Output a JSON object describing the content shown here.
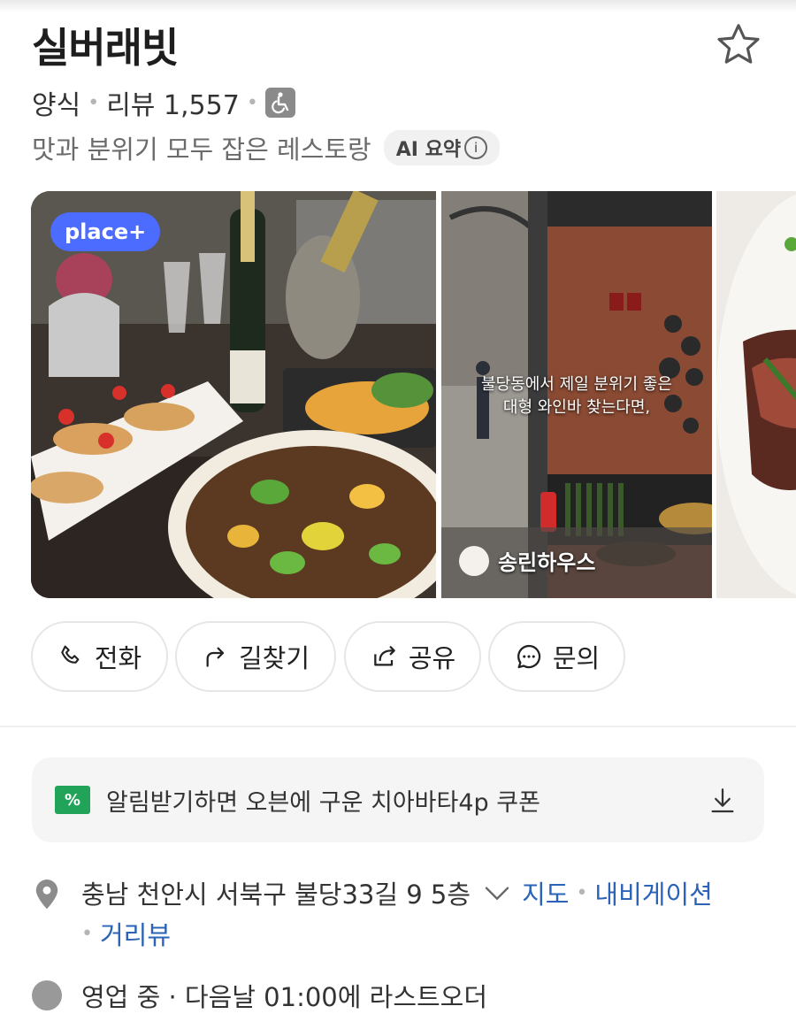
{
  "place": {
    "name": "실버래빗",
    "category": "양식",
    "review_label": "리뷰 1,557",
    "description": "맛과 분위기 모두 잡은 레스토랑",
    "ai_badge": "AI 요약"
  },
  "gallery": {
    "badge": "place+",
    "caption_line1": "불당동에서 제일 분위기 좋은",
    "caption_line2": "대형 와인바 찾는다면,",
    "author": "송린하우스"
  },
  "actions": {
    "call": "전화",
    "directions": "길찾기",
    "share": "공유",
    "inquiry": "문의"
  },
  "coupon": {
    "icon_text": "%",
    "text": "알림받기하면 오븐에 구운 치아바타4p 쿠폰"
  },
  "address": {
    "text": "충남 천안시 서북구 불당33길 9 5층",
    "map": "지도",
    "navigation": "내비게이션",
    "street_view": "거리뷰"
  },
  "hours": {
    "text": "영업 중 · 다음날 01:00에 라스트오더"
  },
  "colors": {
    "accent_blue": "#4c6bff",
    "link_blue": "#2a63b8",
    "coupon_green": "#21a45a"
  }
}
